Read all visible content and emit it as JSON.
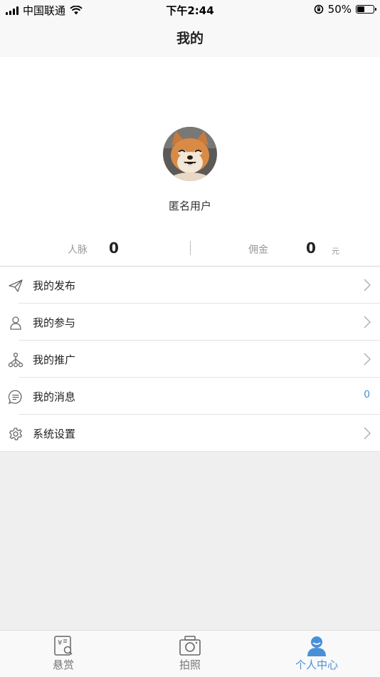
{
  "status_bar": {
    "carrier": "中国联通",
    "time": "下午2:44",
    "battery": "50%",
    "battery_level": 0.5
  },
  "nav": {
    "title": "我的"
  },
  "profile": {
    "username": "匿名用户",
    "avatar_icon": "shiba-dog-avatar",
    "stats": {
      "connections_label": "人脉",
      "connections_value": "0",
      "commission_label": "佣金",
      "commission_value": "0",
      "commission_unit": "元"
    }
  },
  "menu": [
    {
      "label": "我的发布",
      "icon": "paper-plane-icon",
      "trailing": "chevron"
    },
    {
      "label": "我的参与",
      "icon": "user-outline-icon",
      "trailing": "chevron"
    },
    {
      "label": "我的推广",
      "icon": "network-tree-icon",
      "trailing": "chevron"
    },
    {
      "label": "我的消息",
      "icon": "chat-bubble-icon",
      "trailing": "badge",
      "badge": "0"
    },
    {
      "label": "系统设置",
      "icon": "gear-icon",
      "trailing": "chevron"
    }
  ],
  "tabs": [
    {
      "label": "悬赏",
      "icon": "reward-icon",
      "active": false
    },
    {
      "label": "拍照",
      "icon": "camera-icon",
      "active": false
    },
    {
      "label": "个人中心",
      "icon": "person-icon",
      "active": true
    }
  ],
  "colors": {
    "accent": "#4a90d9",
    "background": "#efefef",
    "text": "#222222",
    "muted": "#999999"
  }
}
